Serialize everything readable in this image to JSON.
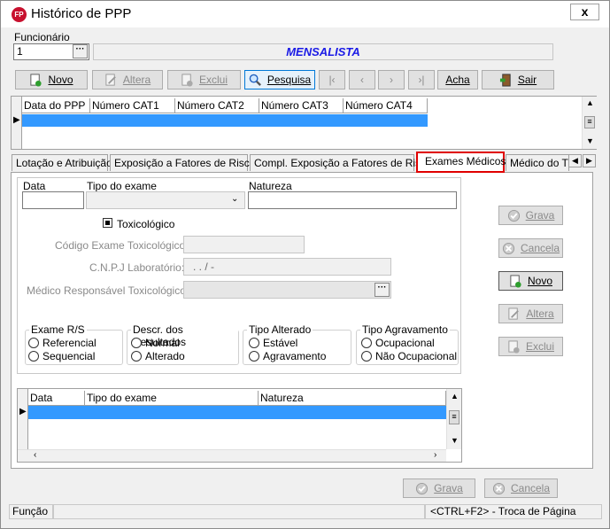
{
  "window": {
    "title": "Histórico de PPP",
    "app_icon_text": "FP",
    "close_label": "x"
  },
  "funcionario": {
    "label": "Funcionário",
    "value": "1",
    "name": "MENSALISTA"
  },
  "toolbar": {
    "novo": "Novo",
    "altera": "Altera",
    "exclui": "Exclui",
    "pesquisa": "Pesquisa",
    "acha": "Acha",
    "sair": "Sair"
  },
  "top_grid": {
    "columns": [
      "Data do PPP",
      "Número CAT1",
      "Número CAT2",
      "Número CAT3",
      "Número CAT4"
    ]
  },
  "tabs": [
    "Lotação e Atribuição",
    "Exposição a Fatores de Riscos",
    "Compl. Exposição a Fatores de Riscos",
    "Exames Médicos",
    "Médico do Tra"
  ],
  "form": {
    "data_label": "Data",
    "tipo_exame_label": "Tipo do exame",
    "natureza_label": "Natureza",
    "toxicologico_label": "Toxicológico",
    "codigo_label": "Código Exame Toxicológico:",
    "cnpj_label": "C.N.P.J Laboratório:",
    "cnpj_mask": ". . / -",
    "medico_label": "Médico Responsável Toxicológico:"
  },
  "groups": {
    "exame_rs": {
      "title": "Exame R/S",
      "options": [
        "Referencial",
        "Sequencial"
      ]
    },
    "descr": {
      "title": "Descr. dos Resultados",
      "options": [
        "Normal",
        "Alterado"
      ]
    },
    "tipo_alt": {
      "title": "Tipo Alterado",
      "options": [
        "Estável",
        "Agravamento"
      ]
    },
    "tipo_agr": {
      "title": "Tipo Agravamento",
      "options": [
        "Ocupacional",
        "Não Ocupacional"
      ]
    }
  },
  "side_buttons": {
    "grava": "Grava",
    "cancela": "Cancela",
    "novo": "Novo",
    "altera": "Altera",
    "exclui": "Exclui"
  },
  "bottom_grid": {
    "columns": [
      "Data",
      "Tipo do exame",
      "Natureza"
    ]
  },
  "footer_buttons": {
    "grava": "Grava",
    "cancela": "Cancela"
  },
  "status": {
    "left": "Função",
    "right": "<CTRL+F2> - Troca de Página"
  }
}
